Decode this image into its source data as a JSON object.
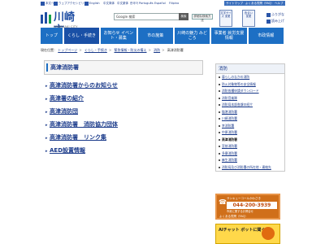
{
  "utility": {
    "left_items": [
      "本文へ",
      "ウェブアクセシビリティ",
      "English",
      "中文简体",
      "中文繁体",
      "한국어",
      "Português",
      "Español",
      "Filipino"
    ],
    "right_items": [
      "サイトマップ",
      "よくある質問（FAQ）",
      "ヘルプ"
    ]
  },
  "header": {
    "logo_text": "川崎市",
    "logo_sub": "KAWASAKI CITY",
    "search_placeholder": "Google 検索",
    "search_button": "検索",
    "search_detail": "詳細な検索方法",
    "box1": "文字サイズ 変更",
    "box2": "色合い 変更",
    "links": [
      "ふりがな",
      "読み上げ"
    ]
  },
  "nav": [
    {
      "label": "トップ"
    },
    {
      "label": "くらし・手続き"
    },
    {
      "label": "お知らせ イベント・募集"
    },
    {
      "label": "市の施策"
    },
    {
      "label": "川崎の魅力 みどころ"
    },
    {
      "label": "事業者 就労支援情報"
    },
    {
      "label": "市政情報"
    }
  ],
  "breadcrumb": {
    "prefix": "現在位置：",
    "items": [
      "トップページ",
      "くらし・手続き",
      "緊急情報・防災の備え",
      "消防",
      "高津消防署"
    ]
  },
  "main": {
    "title": "高津消防署",
    "links": [
      "高津消防署からのお知らせ",
      "高津署の紹介",
      "高津消防団",
      "高津消防署　消防協力団体",
      "高津消防署　リンク集",
      "AED設置情報"
    ]
  },
  "sidebar": {
    "title": "消防",
    "items": [
      "暮らしのなかの消防",
      "防火対象物等の安全情報",
      "消防各種申請ダウンロード",
      "消防音楽隊",
      "消防局本部各課の紹介",
      "臨港消防署",
      "川崎消防署",
      "幸消防署",
      "中原消防署",
      "高津消防署",
      "宮前消防署",
      "多摩消防署",
      "麻生消防署",
      "消防局及び消防署の所在地・連絡先"
    ],
    "current": "高津消防署"
  },
  "callcenter": {
    "line1": "サンキューコールかわさき",
    "phone": "044-200-3939",
    "line3": "市政に関するお問合せ",
    "line4": "よくある質問（FAQ）"
  },
  "chatbot": {
    "label": "AIチャット ボットに聞く"
  }
}
